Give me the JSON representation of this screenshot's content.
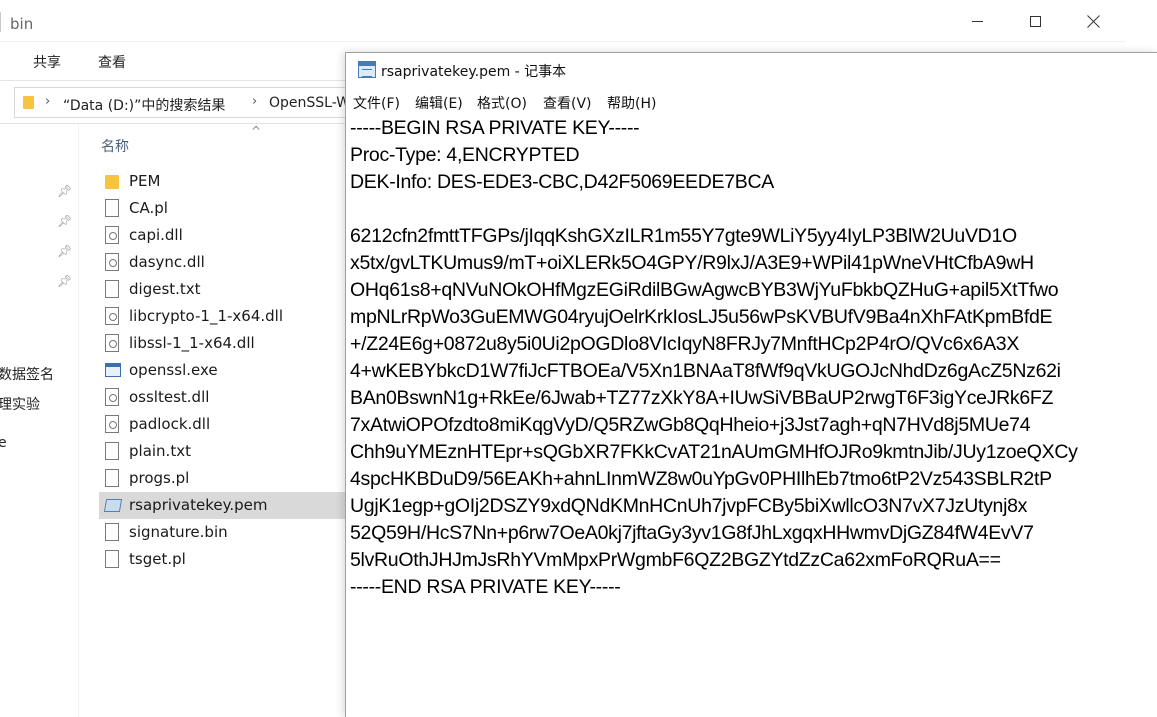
{
  "explorer": {
    "title": "bin",
    "ribbon_tabs": [
      "共享",
      "查看"
    ],
    "address": {
      "crumbs": [
        "“Data (D:)”中的搜索结果",
        "OpenSSL-Wi"
      ]
    },
    "nav_labels": [
      "数据签名",
      "理实验",
      "e"
    ],
    "column_header": "名称",
    "files": [
      {
        "name": "PEM",
        "icon": "folder-icon"
      },
      {
        "name": "CA.pl",
        "icon": "file-icon"
      },
      {
        "name": "capi.dll",
        "icon": "dll-icon"
      },
      {
        "name": "dasync.dll",
        "icon": "dll-icon"
      },
      {
        "name": "digest.txt",
        "icon": "text-file-icon"
      },
      {
        "name": "libcrypto-1_1-x64.dll",
        "icon": "dll-icon"
      },
      {
        "name": "libssl-1_1-x64.dll",
        "icon": "dll-icon"
      },
      {
        "name": "openssl.exe",
        "icon": "exe-icon"
      },
      {
        "name": "ossltest.dll",
        "icon": "dll-icon"
      },
      {
        "name": "padlock.dll",
        "icon": "dll-icon"
      },
      {
        "name": "plain.txt",
        "icon": "text-file-icon"
      },
      {
        "name": "progs.pl",
        "icon": "file-icon"
      },
      {
        "name": "rsaprivatekey.pem",
        "icon": "pem-file-icon",
        "selected": true
      },
      {
        "name": "signature.bin",
        "icon": "file-icon"
      },
      {
        "name": "tsget.pl",
        "icon": "file-icon"
      }
    ]
  },
  "notepad": {
    "title": "rsaprivatekey.pem - 记事本",
    "menu": {
      "file": "文件(F)",
      "edit": "编辑(E)",
      "format": "格式(O)",
      "view": "查看(V)",
      "help": "帮助(H)"
    },
    "lines": [
      "-----BEGIN RSA PRIVATE KEY-----",
      "Proc-Type: 4,ENCRYPTED",
      "DEK-Info: DES-EDE3-CBC,D42F5069EEDE7BCA",
      "",
      "6212cfn2fmttTFGPs/jIqqKshGXzILR1m55Y7gte9WLiY5yy4IyLP3BlW2UuVD1O",
      "x5tx/gvLTKUmus9/mT+oiXLERk5O4GPY/R9lxJ/A3E9+WPil41pWneVHtCfbA9wH",
      "OHq61s8+qNVuNOkOHfMgzEGiRdilBGwAgwcBYB3WjYuFbkbQZHuG+apil5XtTfwo",
      "mpNLrRpWo3GuEMWG04ryujOelrKrkIosLJ5u56wPsKVBUfV9Ba4nXhFAtKpmBfdE",
      "+/Z24E6g+0872u8y5i0Ui2pOGDlo8VIcIqyN8FRJy7MnftHCp2P4rO/QVc6x6A3X",
      "4+wKEBYbkcD1W7fiJcFTBOEa/V5Xn1BNAaT8fWf9qVkUGOJcNhdDz6gAcZ5Nz62i",
      "BAn0BswnN1g+RkEe/6Jwab+TZ77zXkY8A+IUwSiVBBaUP2rwgT6F3igYceJRk6FZ",
      "7xAtwiOPOfzdto8miKqgVyD/Q5RZwGb8QqHheio+j3Jst7agh+qN7HVd8j5MUe74",
      "Chh9uYMEznHTEpr+sQGbXR7FKkCvAT21nAUmGMHfOJRo9kmtnJib/JUy1zoeQXCy",
      "4spcHKBDuD9/56EAKh+ahnLInmWZ8w0uYpGv0PHIlhEb7tmo6tP2Vz543SBLR2tP",
      "UgjK1egp+gOIj2DSZY9xdQNdKMnHCnUh7jvpFCBy5biXwllcO3N7vX7JzUtynj8x",
      "52Q59H/HcS7Nn+p6rw7OeA0kj7jftaGy3yv1G8fJhLxgqxHHwmvDjGZ84fW4EvV7",
      "5lvRuOthJHJmJsRhYVmMpxPrWgmbF6QZ2BGZYtdZzCa62xmFoRQRuA==",
      "-----END RSA PRIVATE KEY-----"
    ]
  }
}
